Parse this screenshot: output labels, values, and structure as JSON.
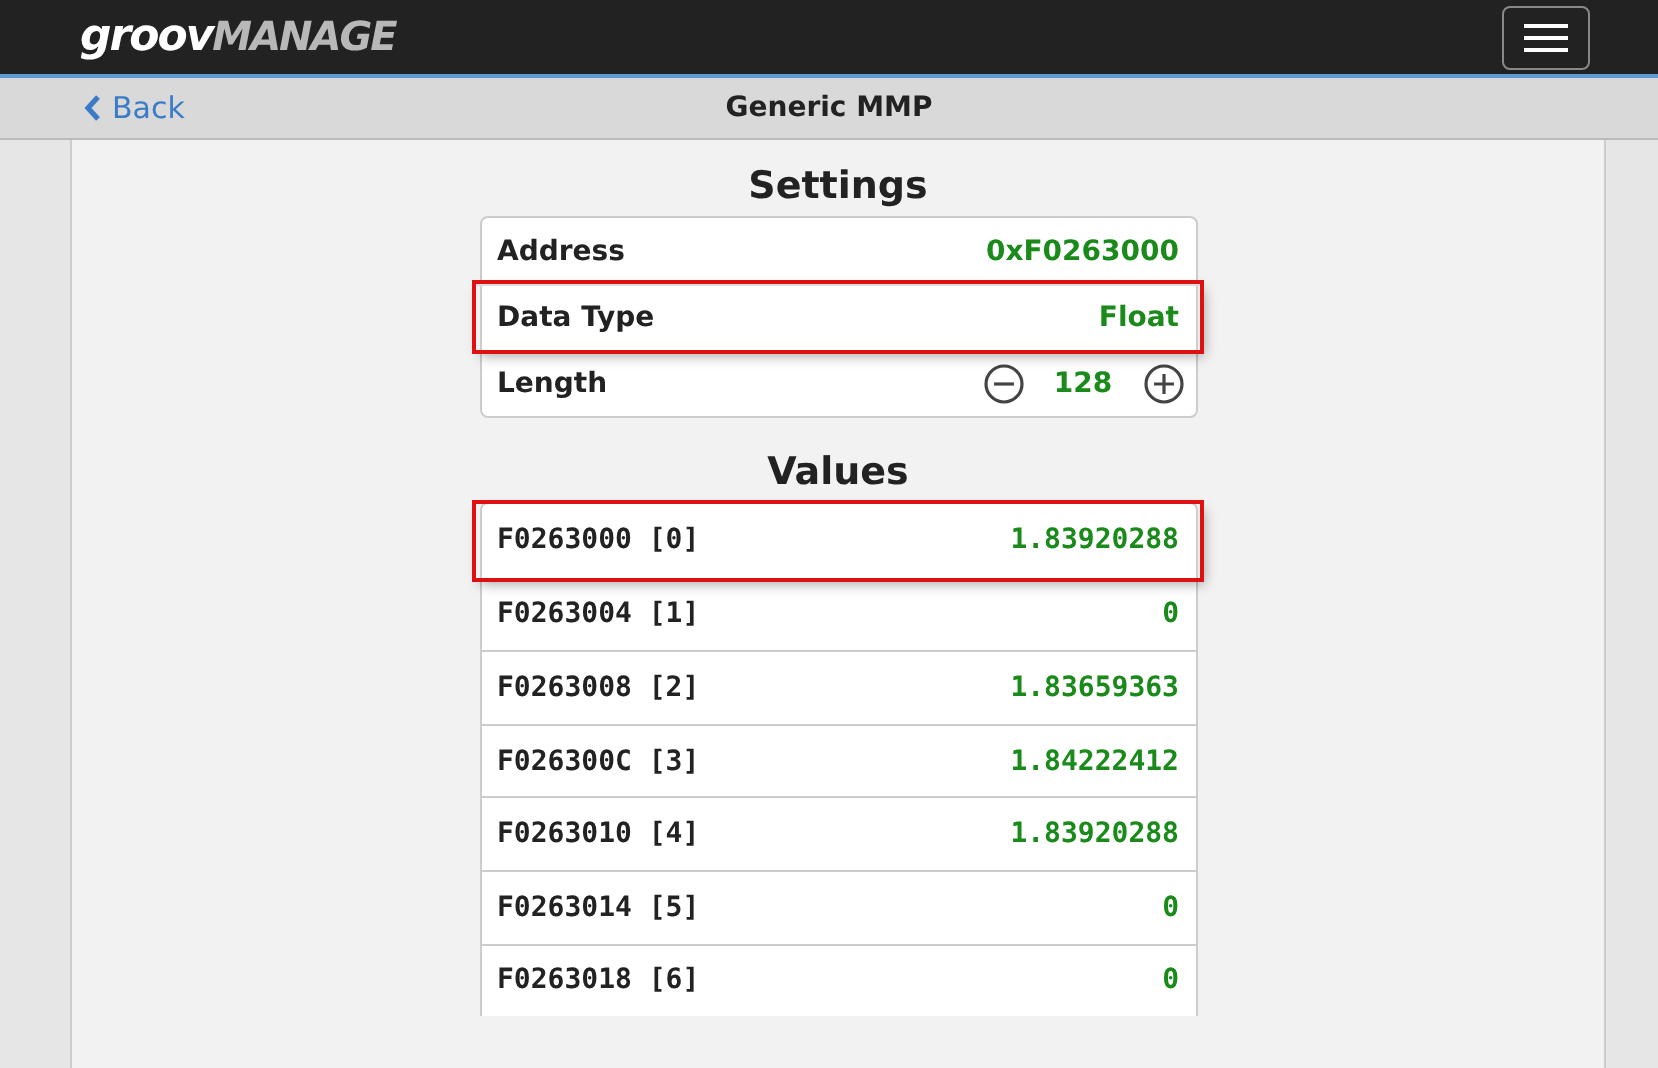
{
  "app_bar": {
    "logo": {
      "brand": "groov",
      "product": "MANAGE"
    }
  },
  "nav_bar": {
    "back": "Back",
    "title": "Generic MMP"
  },
  "settings": {
    "title": "Settings",
    "rows": [
      {
        "kind": "text",
        "label": "Address",
        "value": "0xF0263000",
        "highlighted": false
      },
      {
        "kind": "text",
        "label": "Data Type",
        "value": "Float",
        "highlighted": true
      },
      {
        "kind": "stepper",
        "label": "Length",
        "value": "128",
        "highlighted": false
      }
    ]
  },
  "values": {
    "title": "Values",
    "rows": [
      {
        "address": "F0263000 [0]",
        "value": "1.83920288",
        "highlighted": true
      },
      {
        "address": "F0263004 [1]",
        "value": "0",
        "highlighted": false
      },
      {
        "address": "F0263008 [2]",
        "value": "1.83659363",
        "highlighted": false
      },
      {
        "address": "F026300C [3]",
        "value": "1.84222412",
        "highlighted": false
      },
      {
        "address": "F0263010 [4]",
        "value": "1.83920288",
        "highlighted": false
      },
      {
        "address": "F0263014 [5]",
        "value": "0",
        "highlighted": false
      },
      {
        "address": "F0263018 [6]",
        "value": "0",
        "highlighted": false
      }
    ]
  }
}
